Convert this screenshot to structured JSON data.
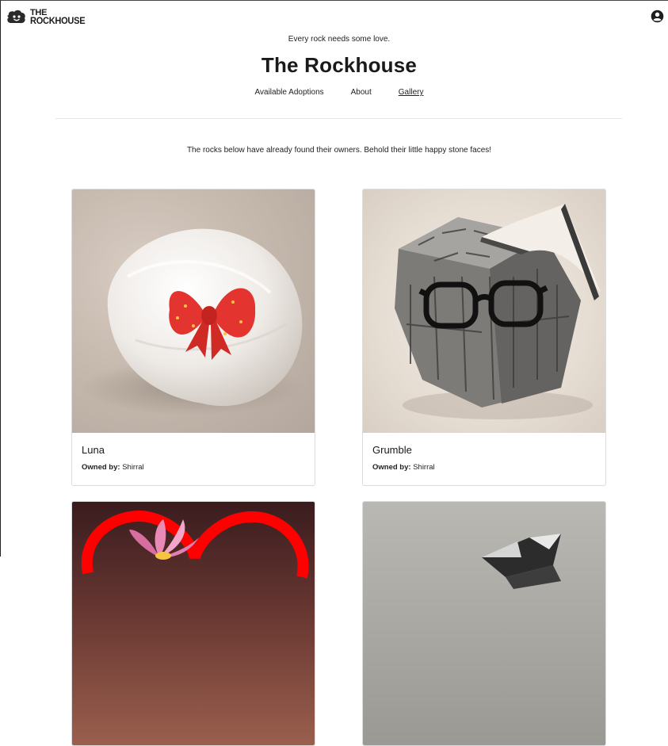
{
  "brand": {
    "line1": "THE",
    "line2": "ROCKHOUSE",
    "logo_icon": "rock-logo-icon"
  },
  "header": {
    "account_icon": "account-circle-icon",
    "tagline": "Every rock needs some love.",
    "title": "The Rockhouse"
  },
  "nav": {
    "items": [
      {
        "label": "Available Adoptions"
      },
      {
        "label": "About"
      },
      {
        "label": "Gallery"
      }
    ],
    "active": "Gallery"
  },
  "gallery": {
    "intro": "The rocks below have already found their owners. Behold their little happy stone faces!",
    "owner_prefix": "Owned by:",
    "cards": [
      {
        "name": "Luna",
        "owner": "Shirral",
        "image": "white stone with red bow"
      },
      {
        "name": "Grumble",
        "owner": "Shirral",
        "image": "grey cube rock with glasses and book"
      },
      {
        "name": "",
        "owner": "",
        "image": "rock with pink lotus and red heart outline"
      },
      {
        "name": "",
        "owner": "",
        "image": "dark shiny crystalline rock"
      }
    ]
  },
  "colors": {
    "text": "#222222",
    "border": "#dcdcdc",
    "bow_red": "#e3342f"
  }
}
